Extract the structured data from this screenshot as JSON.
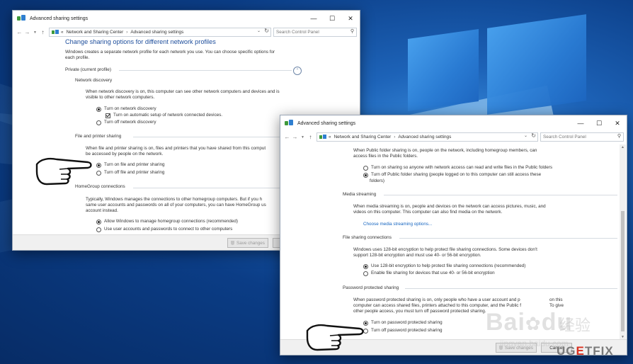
{
  "window_back": {
    "title": "Advanced sharing settings",
    "breadcrumb": [
      "«",
      "Network and Sharing Center",
      "Advanced sharing settings"
    ],
    "search_placeholder": "Search Control Panel",
    "heading": "Change sharing options for different network profiles",
    "intro": [
      "Windows creates a separate network profile for each network you use. You can choose specific options for",
      "each profile."
    ],
    "profile_label": "Private (current profile)",
    "network_discovery": {
      "title": "Network discovery",
      "desc": [
        "When network discovery is on, this computer can see other network computers and devices and is",
        "visible to other network computers."
      ],
      "opt_on": "Turn on network discovery",
      "opt_auto": "Turn on automatic setup of network connected devices.",
      "opt_off": "Turn off network discovery"
    },
    "file_printer": {
      "title": "File and printer sharing",
      "desc": [
        "When file and printer sharing is on, files and printers that you have shared from this comput",
        "be accessed by people on the network."
      ],
      "opt_on": "Turn on file and printer sharing",
      "opt_off": "Turn off file and printer sharing"
    },
    "homegroup": {
      "title": "HomeGroup connections",
      "desc": [
        "Typically, Windows manages the connections to other homegroup computers. But if you h",
        "same user accounts and passwords on all of your computers, you can have HomeGroup us",
        "account instead."
      ],
      "opt_allow": "Allow Windows to manage homegroup connections (recommended)",
      "opt_user": "Use user accounts and passwords to connect to other computers"
    },
    "save_label": "Save changes"
  },
  "window_front": {
    "title": "Advanced sharing settings",
    "breadcrumb": [
      "«",
      "Network and Sharing Center",
      "Advanced sharing settings"
    ],
    "search_placeholder": "Search Control Panel",
    "public_folder": {
      "desc": [
        "When Public folder sharing is on, people on the network, including homegroup members, can",
        "access files in the Public folders."
      ],
      "opt_on": "Turn on sharing so anyone with network access can read and write files in the Public folders",
      "opt_off": "Turn off Public folder sharing (people logged on to this computer can still access these",
      "opt_off_2": "folders)"
    },
    "media": {
      "title": "Media streaming",
      "desc": [
        "When media streaming is on, people and devices on the network can access pictures, music, and",
        "videos on this computer. This computer can also find media on the network."
      ],
      "link": "Choose media streaming options..."
    },
    "file_sharing": {
      "title": "File sharing connections",
      "desc": [
        "Windows uses 128-bit encryption to help protect file sharing connections. Some devices don't",
        "support 128-bit encryption and must use 40- or 56-bit encryption."
      ],
      "opt_128": "Use 128-bit encryption to help protect file sharing connections (recommended)",
      "opt_40": "Enable file sharing for devices that use 40- or 56-bit encryption"
    },
    "password": {
      "title": "Password protected sharing",
      "desc": [
        "When password protected sharing is on, only people who have a user account and p",
        "computer can access shared files, printers attached to this computer, and the Public f",
        "other people access, you must turn off password protected sharing."
      ],
      "desc_tail": [
        "on this",
        "To give"
      ],
      "opt_on": "Turn on password protected sharing",
      "opt_off": "Turn off password protected sharing"
    },
    "save_label": "Save changes",
    "cancel_label": "Cancel"
  },
  "watermark": {
    "baidu_logo": "Bai",
    "baidu_du": "du",
    "baidu_cn": "经验",
    "baidu_url": "jingyan.baidu.com",
    "ugetfix": "UG",
    "ugetfix_e": "E",
    "ugetfix_tfix": "TFIX"
  },
  "colors": {
    "accent_link": "#1565c0",
    "heading": "#1e4e9c",
    "ugetfix_red": "#d9301f"
  }
}
